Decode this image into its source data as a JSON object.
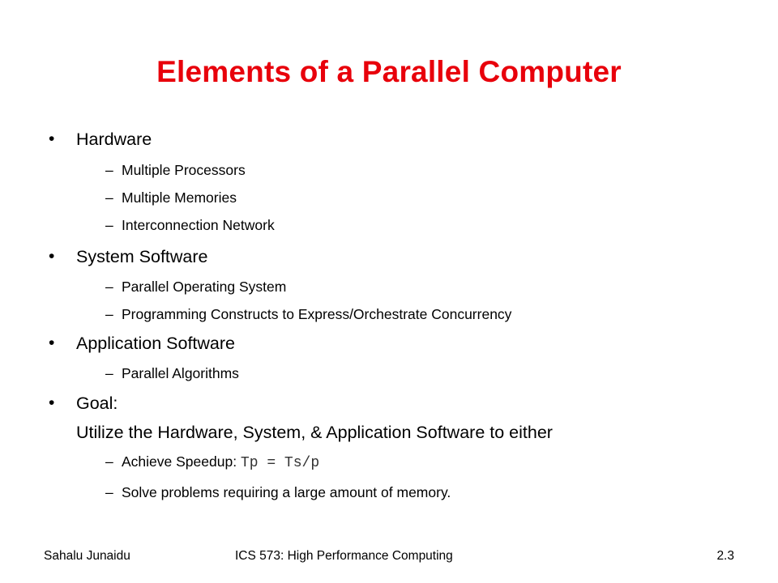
{
  "slide": {
    "title": "Elements of a Parallel Computer",
    "title_color": "#e8000b",
    "bullet_glyph": "•",
    "dash_glyph": "–",
    "sections": [
      {
        "heading": "Hardware",
        "items": [
          "Multiple Processors",
          "Multiple Memories",
          "Interconnection Network"
        ]
      },
      {
        "heading": "System Software",
        "items": [
          "Parallel Operating System",
          "Programming Constructs to Express/Orchestrate Concurrency"
        ]
      },
      {
        "heading": "Application Software",
        "items": [
          "Parallel Algorithms"
        ]
      },
      {
        "heading": "Goal:",
        "continuation": "Utilize the Hardware, System, & Application Software to either",
        "items": [
          {
            "text": "Achieve Speedup: ",
            "code": "Tp = Ts/p"
          },
          "Solve problems requiring a large amount of memory."
        ]
      }
    ]
  },
  "footer": {
    "author": "Sahalu Junaidu",
    "course": "ICS 573: High Performance Computing",
    "slide_number": "2.3"
  }
}
